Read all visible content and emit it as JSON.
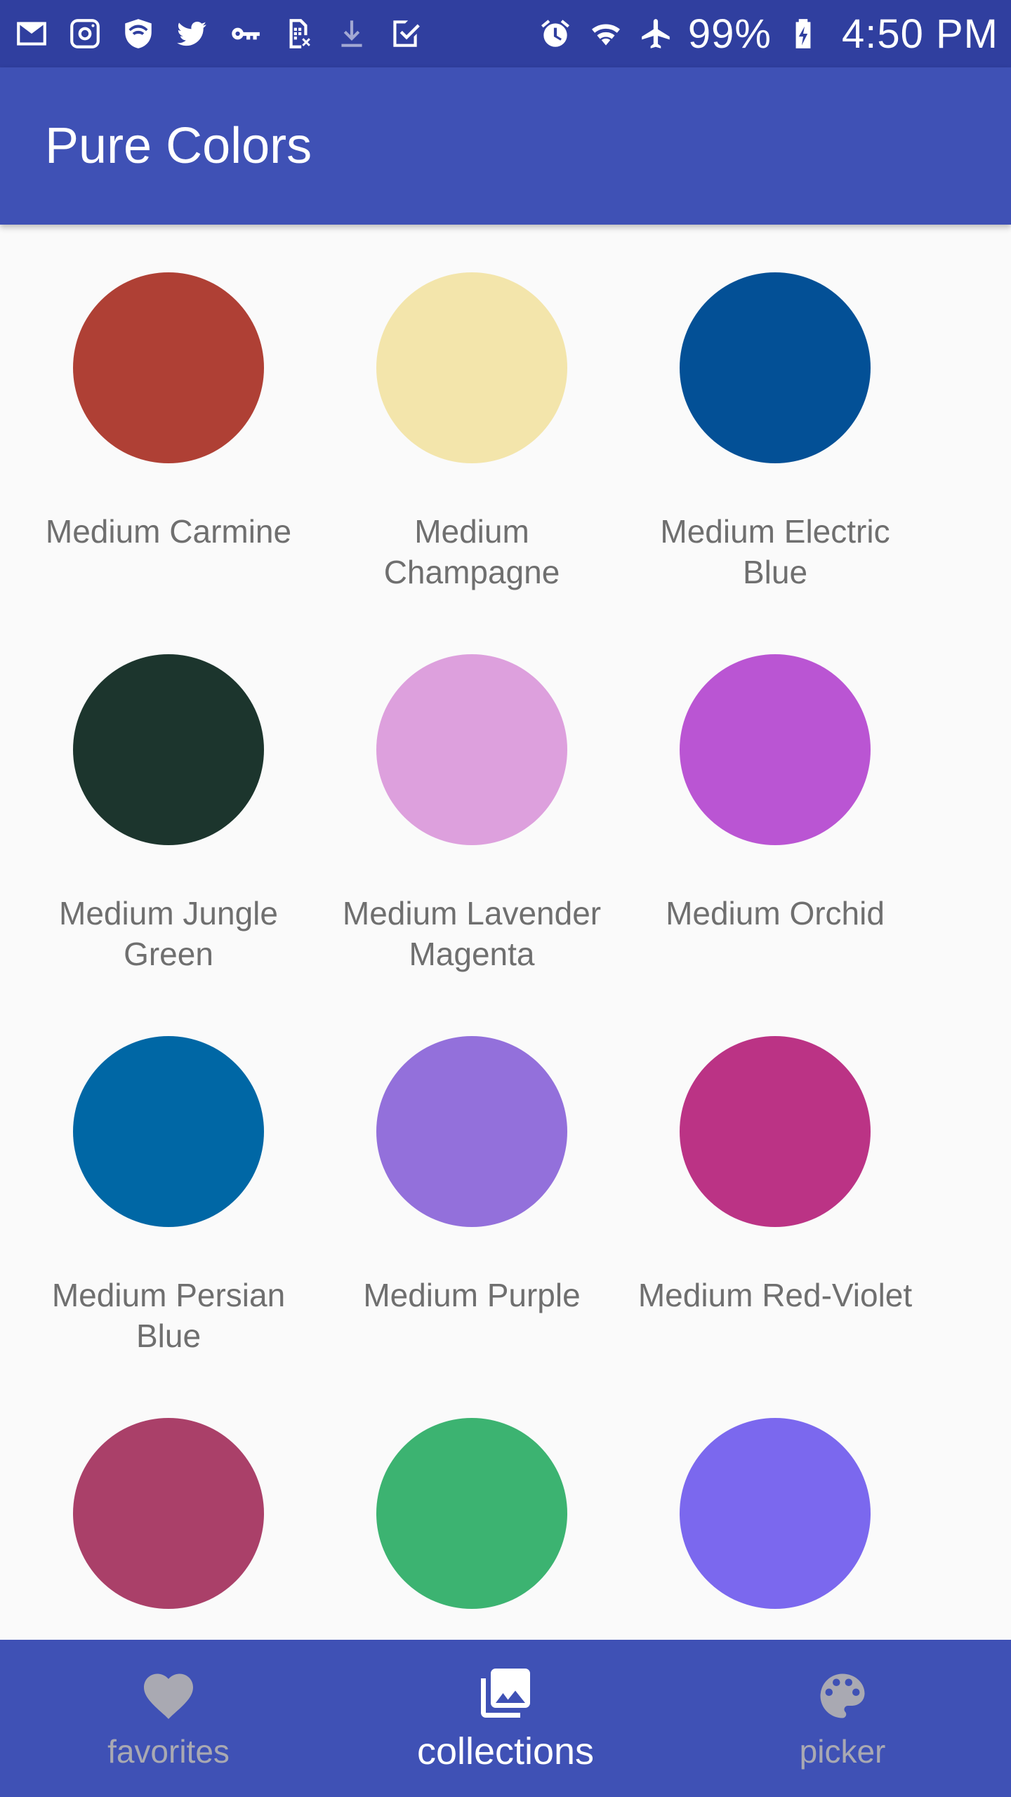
{
  "status_bar": {
    "left_icons": [
      "gmail-icon",
      "instagram-icon",
      "shield-icon",
      "twitter-icon",
      "key-icon",
      "sim-icon",
      "download-icon",
      "check-icon"
    ],
    "right_icons": [
      "alarm-icon",
      "wifi-icon",
      "airplane-icon",
      "battery-icon"
    ],
    "battery_percent": "99%",
    "time": "4:50 PM"
  },
  "app_bar": {
    "title": "Pure Colors"
  },
  "swatches": [
    {
      "name": "Medium Carmine",
      "color": "#af4035"
    },
    {
      "name": "Medium Champagne",
      "color": "#f3e5ab"
    },
    {
      "name": "Medium Electric Blue",
      "color": "#035096"
    },
    {
      "name": "Medium Jungle Green",
      "color": "#1c352d"
    },
    {
      "name": "Medium Lavender Magenta",
      "color": "#dda0dd"
    },
    {
      "name": "Medium Orchid",
      "color": "#ba55d3"
    },
    {
      "name": "Medium Persian Blue",
      "color": "#0067a5"
    },
    {
      "name": "Medium Purple",
      "color": "#9370db"
    },
    {
      "name": "Medium Red-Violet",
      "color": "#bb3385"
    },
    {
      "name": "",
      "color": "#aa4069"
    },
    {
      "name": "",
      "color": "#3cb371"
    },
    {
      "name": "",
      "color": "#7b68ee"
    }
  ],
  "bottom_nav": {
    "items": [
      {
        "label": "favorites",
        "icon": "heart-icon",
        "active": false
      },
      {
        "label": "collections",
        "icon": "collections-icon",
        "active": true
      },
      {
        "label": "picker",
        "icon": "palette-icon",
        "active": false
      }
    ]
  }
}
